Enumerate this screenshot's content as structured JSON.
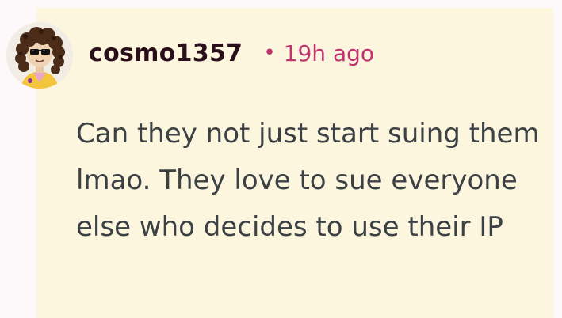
{
  "comment": {
    "username": "cosmo1357",
    "separator": "•",
    "timestamp": "19h ago",
    "body": "Can they not just start suing them lmao. They love to sue everyone else who decides to use their IP"
  },
  "colors": {
    "page_background": "#fdf8f9",
    "card_background": "#fdf6de",
    "username": "#2a0f1b",
    "timestamp": "#c0336f",
    "body_text": "#3b4144"
  },
  "icons": {
    "avatar": "user-avatar-curly-hair-sunglasses"
  }
}
